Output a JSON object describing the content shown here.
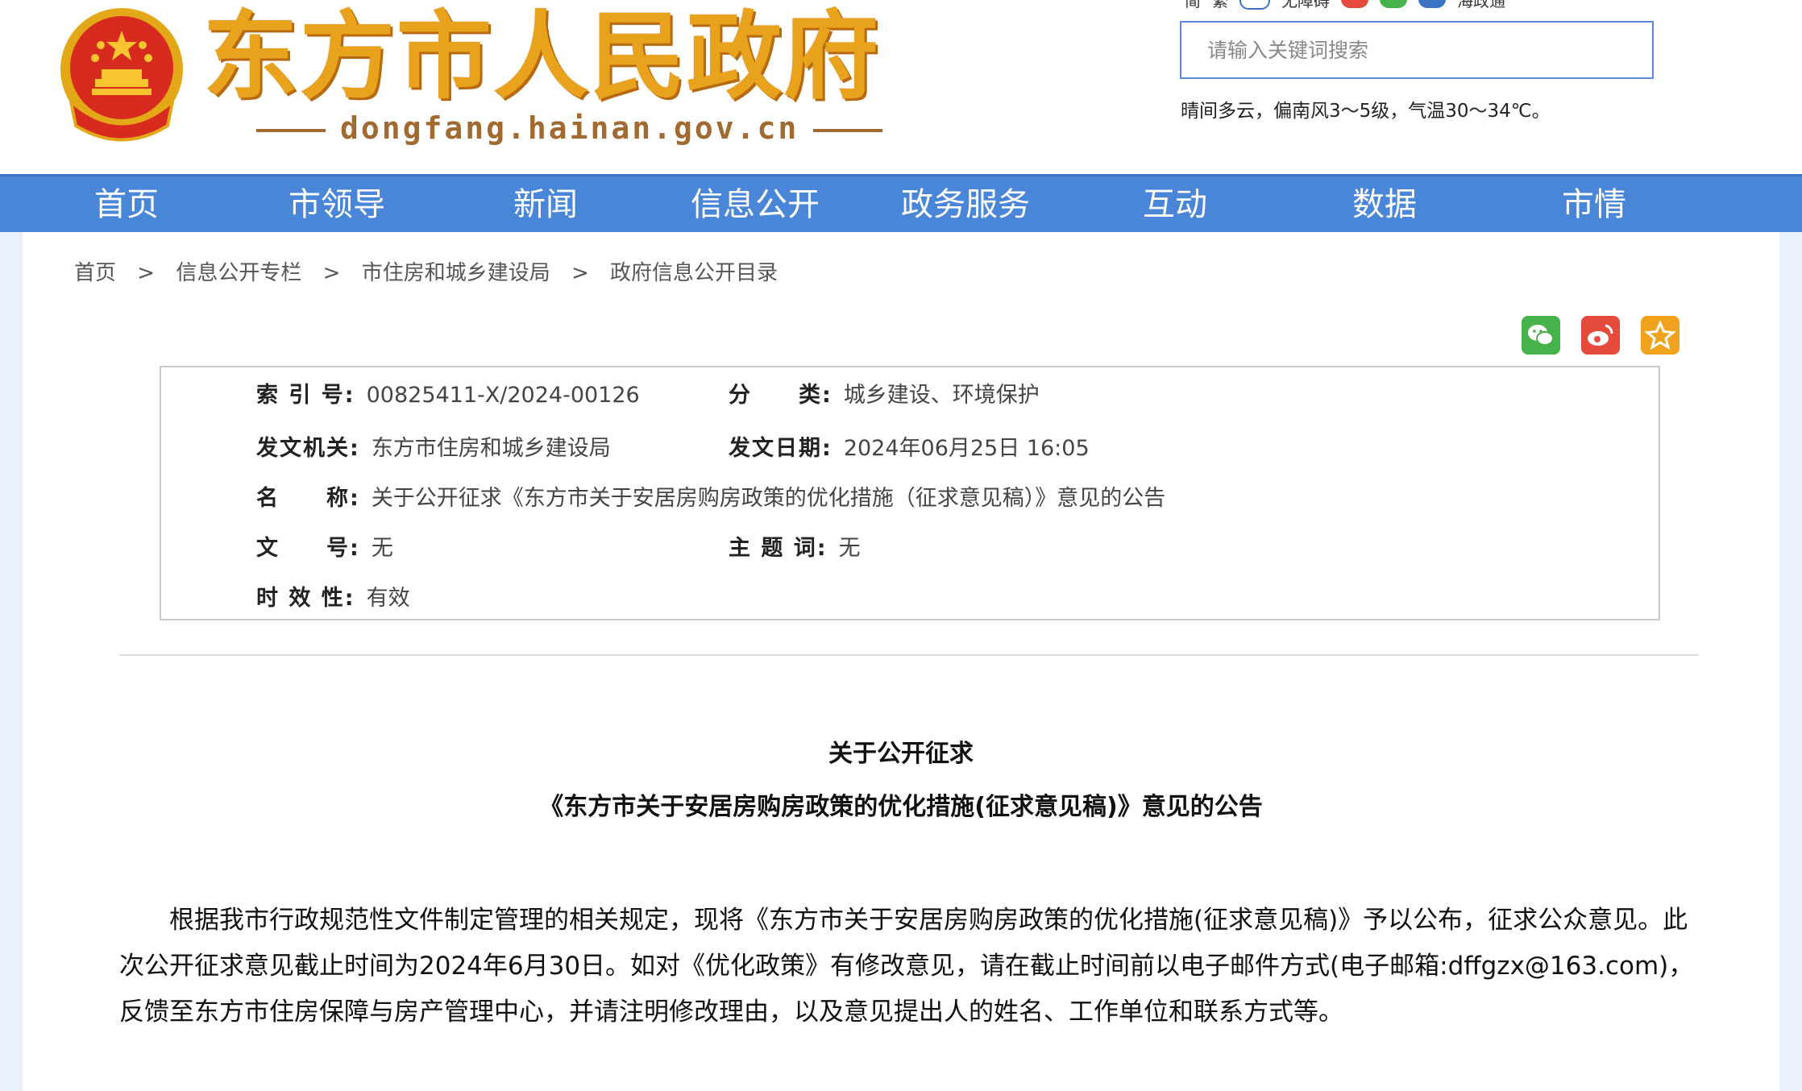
{
  "header": {
    "site_title": "东方市人民政府",
    "site_url": "dongfang.hainan.gov.cn",
    "top_links": [
      "简",
      "繁",
      "无障碍",
      "微博",
      "微信",
      "海政通"
    ],
    "search_placeholder": "请输入关键词搜索",
    "weather": "晴间多云，偏南风3～5级，气温30～34℃。",
    "emblem_icon": "national-emblem-icon",
    "accent_color": "#e8a21c"
  },
  "nav": {
    "color": "#4a86d8",
    "items": [
      "首页",
      "市领导",
      "新闻",
      "信息公开",
      "政务服务",
      "互动",
      "数据",
      "市情"
    ]
  },
  "breadcrumb": [
    "首页",
    "信息公开专栏",
    "市住房和城乡建设局",
    "政府信息公开目录"
  ],
  "breadcrumb_sep": ">",
  "share": {
    "icons": [
      "wechat-icon",
      "weibo-icon",
      "favorite-icon"
    ]
  },
  "meta": {
    "index_no_label": "索 引 号:",
    "index_no": "00825411-X/2024-00126",
    "category_label": "分　　类:",
    "category": "城乡建设、环境保护",
    "issuer_label": "发文机关:",
    "issuer": "东方市住房和城乡建设局",
    "date_label": "发文日期:",
    "date": "2024年06月25日 16:05",
    "name_label": "名　　称:",
    "name": "关于公开征求《东方市关于安居房购房政策的优化措施（征求意见稿）》意见的公告",
    "doc_no_label": "文　　号:",
    "doc_no": "无",
    "keywords_label": "主 题 词:",
    "keywords": "无",
    "validity_label": "时 效 性:",
    "validity": "有效"
  },
  "document": {
    "title_line1": "关于公开征求",
    "title_line2": "《东方市关于安居房购房政策的优化措施(征求意见稿)》意见的公告",
    "body": "根据我市行政规范性文件制定管理的相关规定，现将《东方市关于安居房购房政策的优化措施(征求意见稿)》予以公布，征求公众意见。此次公开征求意见截止时间为2024年6月30日。如对《优化政策》有修改意见，请在截止时间前以电子邮件方式(电子邮箱:dffgzx@163.com)，反馈至东方市住房保障与房产管理中心，并请注明修改理由，以及意见提出人的姓名、工作单位和联系方式等。"
  }
}
